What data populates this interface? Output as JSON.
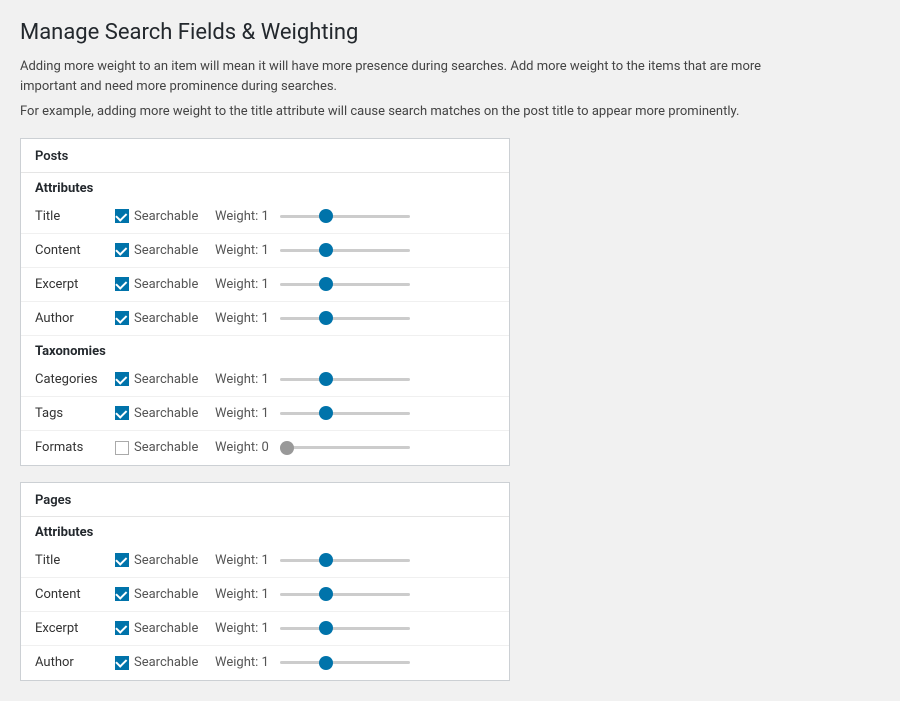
{
  "page": {
    "title": "Manage Search Fields & Weighting",
    "descriptions": [
      "Adding more weight to an item will mean it will have more presence during searches. Add more weight to the items that are more important and need more prominence during searches.",
      "For example, adding more weight to the title attribute will cause search matches on the post title to appear more prominently."
    ]
  },
  "sections": [
    {
      "id": "posts",
      "title": "Posts",
      "groups": [
        {
          "id": "attributes",
          "label": "Attributes",
          "fields": [
            {
              "id": "posts-title",
              "name": "Title",
              "searchable": true,
              "weight": 1
            },
            {
              "id": "posts-content",
              "name": "Content",
              "searchable": true,
              "weight": 1
            },
            {
              "id": "posts-excerpt",
              "name": "Excerpt",
              "searchable": true,
              "weight": 1
            },
            {
              "id": "posts-author",
              "name": "Author",
              "searchable": true,
              "weight": 1
            }
          ]
        },
        {
          "id": "taxonomies",
          "label": "Taxonomies",
          "fields": [
            {
              "id": "posts-categories",
              "name": "Categories",
              "searchable": true,
              "weight": 1
            },
            {
              "id": "posts-tags",
              "name": "Tags",
              "searchable": true,
              "weight": 1
            },
            {
              "id": "posts-formats",
              "name": "Formats",
              "searchable": false,
              "weight": 0
            }
          ]
        }
      ]
    },
    {
      "id": "pages",
      "title": "Pages",
      "groups": [
        {
          "id": "attributes",
          "label": "Attributes",
          "fields": [
            {
              "id": "pages-title",
              "name": "Title",
              "searchable": true,
              "weight": 1
            },
            {
              "id": "pages-content",
              "name": "Content",
              "searchable": true,
              "weight": 1
            },
            {
              "id": "pages-excerpt",
              "name": "Excerpt",
              "searchable": true,
              "weight": 1
            },
            {
              "id": "pages-author",
              "name": "Author",
              "searchable": true,
              "weight": 1
            }
          ]
        }
      ]
    }
  ],
  "labels": {
    "searchable": "Searchable",
    "weight_prefix": "Weight: "
  },
  "colors": {
    "accent": "#0073aa",
    "disabled": "#999"
  }
}
